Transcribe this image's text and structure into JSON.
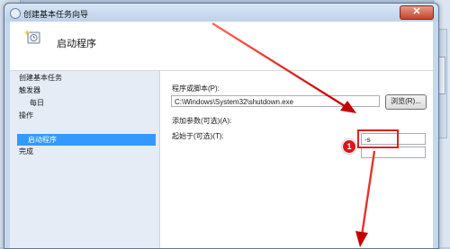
{
  "window": {
    "title": "创建基本任务向导",
    "close_glyph": "✕"
  },
  "header": {
    "heading": "启动程序"
  },
  "steps": {
    "group": "创建基本任务",
    "trigger": "触发器",
    "daily": "每日",
    "action": "操作",
    "start_program": "启动程序",
    "finish": "完成"
  },
  "form": {
    "program_label": "程序或脚本(P):",
    "program_value": "C:\\Windows\\System32\\shutdown.exe",
    "browse_label": "浏览(R)...",
    "args_label": "添加参数(可选)(A):",
    "args_value": "-s",
    "start_in_label": "起始于(可选)(T):",
    "start_in_value": ""
  },
  "annotation": {
    "callout_number": "1",
    "color": "#e02020"
  },
  "icons": [
    "app-icon",
    "wizard-task-icon",
    "close-icon"
  ]
}
